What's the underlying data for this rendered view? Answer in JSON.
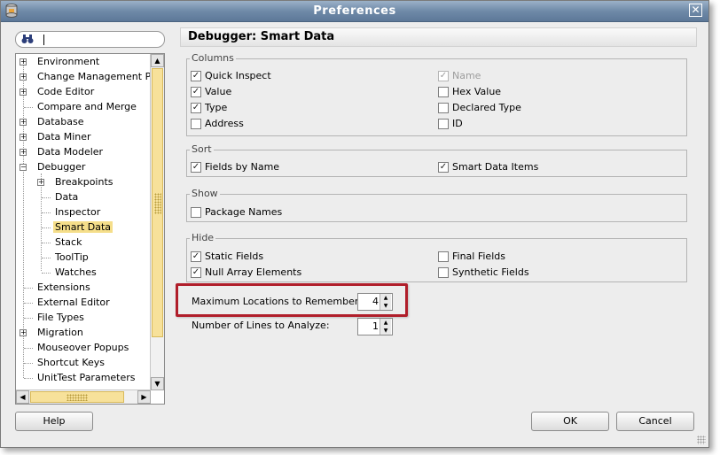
{
  "window": {
    "title": "Preferences",
    "close_label": "✕"
  },
  "search": {
    "value": "",
    "icon": "binoculars-icon"
  },
  "tree": {
    "items": [
      {
        "label": "Environment",
        "expand": "+"
      },
      {
        "label": "Change Management Pa",
        "expand": "+"
      },
      {
        "label": "Code Editor",
        "expand": "+"
      },
      {
        "label": "Compare and Merge",
        "expand": ""
      },
      {
        "label": "Database",
        "expand": "+"
      },
      {
        "label": "Data Miner",
        "expand": "+"
      },
      {
        "label": "Data Modeler",
        "expand": "+"
      },
      {
        "label": "Debugger",
        "expand": "−"
      },
      {
        "label": "Breakpoints",
        "expand": "+"
      },
      {
        "label": "Data",
        "expand": ""
      },
      {
        "label": "Inspector",
        "expand": ""
      },
      {
        "label": "Smart Data",
        "expand": ""
      },
      {
        "label": "Stack",
        "expand": ""
      },
      {
        "label": "ToolTip",
        "expand": ""
      },
      {
        "label": "Watches",
        "expand": ""
      },
      {
        "label": "Extensions",
        "expand": ""
      },
      {
        "label": "External Editor",
        "expand": ""
      },
      {
        "label": "File Types",
        "expand": ""
      },
      {
        "label": "Migration",
        "expand": "+"
      },
      {
        "label": "Mouseover Popups",
        "expand": ""
      },
      {
        "label": "Shortcut Keys",
        "expand": ""
      },
      {
        "label": "UnitTest Parameters",
        "expand": ""
      }
    ],
    "selected": "Smart Data",
    "highlight_color": "#f5de8a"
  },
  "page": {
    "title": "Debugger: Smart Data",
    "columns": {
      "legend": "Columns",
      "quick_inspect": {
        "label": "Quick Inspect",
        "checked": true
      },
      "value": {
        "label": "Value",
        "checked": true
      },
      "type": {
        "label": "Type",
        "checked": true
      },
      "address": {
        "label": "Address",
        "checked": false
      },
      "name": {
        "label": "Name",
        "checked": true,
        "disabled": true
      },
      "hex_value": {
        "label": "Hex Value",
        "checked": false
      },
      "declared_type": {
        "label": "Declared Type",
        "checked": false
      },
      "id": {
        "label": "ID",
        "checked": false
      }
    },
    "sort": {
      "legend": "Sort",
      "fields_by_name": {
        "label": "Fields by Name",
        "checked": true
      },
      "smart_data_items": {
        "label": "Smart Data Items",
        "checked": true
      }
    },
    "show": {
      "legend": "Show",
      "package_names": {
        "label": "Package Names",
        "checked": false
      }
    },
    "hide": {
      "legend": "Hide",
      "static_fields": {
        "label": "Static Fields",
        "checked": true
      },
      "null_array_elements": {
        "label": "Null Array Elements",
        "checked": true
      },
      "final_fields": {
        "label": "Final Fields",
        "checked": false
      },
      "synthetic_fields": {
        "label": "Synthetic Fields",
        "checked": false
      }
    },
    "max_locations": {
      "label": "Maximum Locations to Remember:",
      "value": "4"
    },
    "lines_to_analyze": {
      "label": "Number of Lines to Analyze:",
      "value": "1"
    },
    "highlight_color": "#b01e2a"
  },
  "buttons": {
    "help": "Help",
    "ok": "OK",
    "cancel": "Cancel"
  }
}
